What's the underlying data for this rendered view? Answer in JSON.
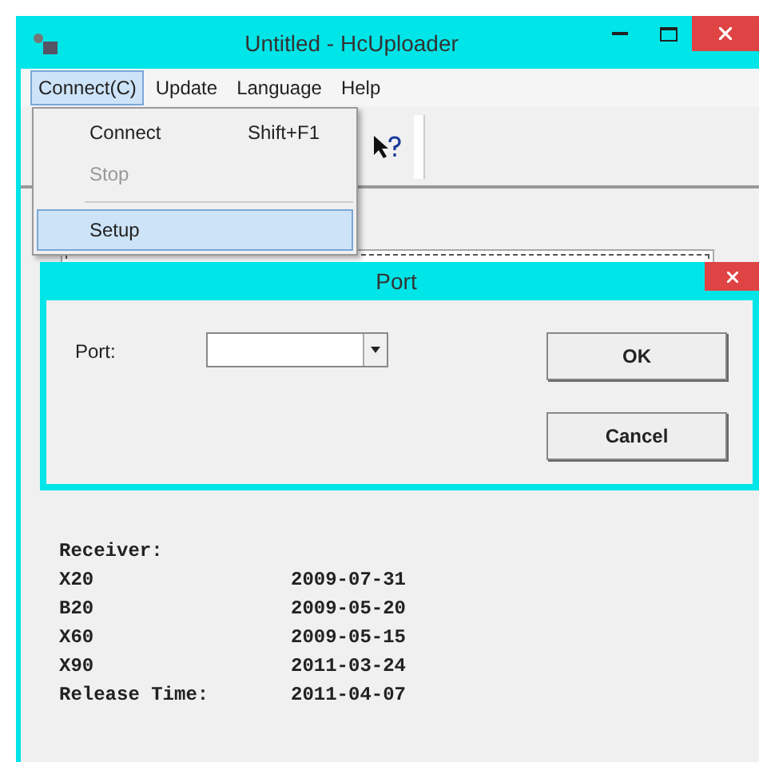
{
  "window": {
    "title": "Untitled - HcUploader"
  },
  "menu": [
    {
      "label": "Connect(C)",
      "selected": true
    },
    {
      "label": "Update",
      "selected": false
    },
    {
      "label": "Language",
      "selected": false
    },
    {
      "label": "Help",
      "selected": false
    }
  ],
  "dropdown": [
    {
      "kind": "item",
      "label": "Connect",
      "shortcut": "Shift+F1",
      "disabled": false,
      "selected": false
    },
    {
      "kind": "item",
      "label": "Stop",
      "disabled": true,
      "selected": false
    },
    {
      "kind": "separator"
    },
    {
      "kind": "item",
      "label": "Setup",
      "disabled": false,
      "selected": true
    }
  ],
  "dialog": {
    "title": "Port",
    "field_label": "Port:",
    "buttons": [
      "OK",
      "Cancel"
    ]
  },
  "receiver": {
    "heading": "Receiver:",
    "rows": [
      {
        "label": "X20",
        "value": "2009-07-31"
      },
      {
        "label": "B20",
        "value": "2009-05-20"
      },
      {
        "label": "X60",
        "value": "2009-05-15"
      },
      {
        "label": "X90",
        "value": "2011-03-24"
      },
      {
        "label": "Release Time:",
        "value": "2011-04-07"
      }
    ]
  }
}
